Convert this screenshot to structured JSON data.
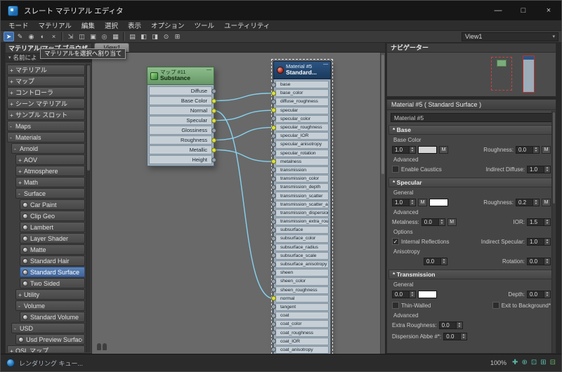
{
  "colors": {
    "wire": "#86d2ef",
    "socket_connected": "#dade4a",
    "selection_blue": "#40639a",
    "substance_header": "#699869",
    "material_header": "#1b3a5c",
    "statusbar_icon_teal": "#58b8a8"
  },
  "ui": {
    "minimize_glyph": "—",
    "dropdown_arrow": "▾",
    "check": "✓",
    "spin_up": "▲",
    "spin_down": "▼"
  },
  "window": {
    "title": "スレート マテリアル エディタ",
    "buttons": [
      {
        "name": "minimize-button",
        "glyph": "—"
      },
      {
        "name": "maximize-button",
        "glyph": "□"
      },
      {
        "name": "close-button",
        "glyph": "×"
      }
    ]
  },
  "menubar": {
    "items": [
      {
        "name": "menu-mode",
        "label": "モード"
      },
      {
        "name": "menu-material",
        "label": "マテリアル"
      },
      {
        "name": "menu-edit",
        "label": "編集"
      },
      {
        "name": "menu-select",
        "label": "選択"
      },
      {
        "name": "menu-view",
        "label": "表示"
      },
      {
        "name": "menu-options",
        "label": "オプション"
      },
      {
        "name": "menu-tools",
        "label": "ツール"
      },
      {
        "name": "menu-utilities",
        "label": "ユーティリティ"
      }
    ]
  },
  "toolbar": {
    "view_selector": "View1",
    "icons": [
      {
        "name": "select-tool-button",
        "glyph": "➤",
        "active": true
      },
      {
        "name": "pick-material-from-object-button",
        "glyph": "✎"
      },
      {
        "name": "put-material-to-scene-button",
        "glyph": "◉"
      },
      {
        "name": "assign-material-to-selection-button",
        "glyph": "◐"
      },
      {
        "name": "delete-selected-button",
        "glyph": "×"
      },
      {
        "name": "toolbar-separator",
        "sep": true
      },
      {
        "name": "move-children-button",
        "glyph": "⇲"
      },
      {
        "name": "hide-unused-nodeslots-button",
        "glyph": "◫"
      },
      {
        "name": "show-shaded-material-button",
        "glyph": "▣"
      },
      {
        "name": "show-end-result-button",
        "glyph": "◎"
      },
      {
        "name": "lay-out-all-button",
        "glyph": "▦"
      },
      {
        "name": "toolbar-separator",
        "sep": true
      },
      {
        "name": "lay-out-children-button",
        "glyph": "▤"
      },
      {
        "name": "material-map-browser-toggle-button",
        "glyph": "◧"
      },
      {
        "name": "parameter-editor-toggle-button",
        "glyph": "◨"
      },
      {
        "name": "select-by-material-button",
        "glyph": "⊙"
      },
      {
        "name": "zoom-extents-button",
        "glyph": "⊞"
      }
    ]
  },
  "browser": {
    "title": "マテリアル/マップ ブラウザ",
    "search_text": "名前によ",
    "tooltip": "マテリアルを選択へ割り当て",
    "items": [
      {
        "name": "browser-item-materials-group",
        "expander": "+",
        "label": "マテリアル",
        "indent": 0
      },
      {
        "name": "browser-item-maps-group",
        "expander": "+",
        "label": "マップ",
        "indent": 0
      },
      {
        "name": "browser-item-controllers",
        "expander": "+",
        "label": "コントローラ",
        "indent": 0
      },
      {
        "name": "browser-item-scene-materials",
        "expander": "+",
        "label": "シーン マテリアル",
        "indent": 0
      },
      {
        "name": "browser-item-sample-slots",
        "expander": "+",
        "label": "サンプル スロット",
        "indent": 0
      },
      {
        "expander": "-",
        "label": "Maps",
        "indent": 0
      },
      {
        "expander": "-",
        "label": "Materials",
        "indent": 0
      },
      {
        "expander": "-",
        "label": "Arnold",
        "indent": 1
      },
      {
        "expander": "+",
        "label": "AOV",
        "indent": 2
      },
      {
        "expander": "+",
        "label": "Atmosphere",
        "indent": 2
      },
      {
        "expander": "+",
        "label": "Math",
        "indent": 2
      },
      {
        "expander": "-",
        "label": "Surface",
        "indent": 2
      },
      {
        "icon": "ball",
        "label": "Car Paint",
        "indent": 3
      },
      {
        "icon": "ball",
        "label": "Clip Geo",
        "indent": 3
      },
      {
        "icon": "ball",
        "label": "Lambert",
        "indent": 3
      },
      {
        "icon": "ball",
        "label": "Layer Shader",
        "indent": 3
      },
      {
        "icon": "ball",
        "label": "Matte",
        "indent": 3
      },
      {
        "icon": "ball",
        "label": "Standard Hair",
        "indent": 3
      },
      {
        "icon": "ball",
        "label": "Standard Surface",
        "indent": 3,
        "selected": true
      },
      {
        "icon": "ball",
        "label": "Two Sided",
        "indent": 3
      },
      {
        "expander": "+",
        "label": "Utility",
        "indent": 2
      },
      {
        "expander": "-",
        "label": "Volume",
        "indent": 2
      },
      {
        "icon": "ball",
        "label": "Standard Volume",
        "indent": 3
      },
      {
        "expander": "-",
        "label": "USD",
        "indent": 1
      },
      {
        "icon": "ball",
        "label": "Usd Preview Surface",
        "indent": 2
      },
      {
        "name": "browser-item-osl-maps",
        "expander": "+",
        "label": "OSL マップ",
        "indent": 0
      }
    ]
  },
  "canvas": {
    "tab": "View1",
    "nodes": {
      "substance": {
        "title": "マップ #11",
        "subtitle": "Substance",
        "outputs": [
          {
            "label": "Diffuse"
          },
          {
            "label": "Base Color",
            "connected": true
          },
          {
            "label": "Normal",
            "connected": true
          },
          {
            "label": "Specular",
            "connected": true
          },
          {
            "label": "Glossiness"
          },
          {
            "label": "Roughness",
            "connected": true
          },
          {
            "label": "Metallic",
            "connected": true
          },
          {
            "label": "Height"
          }
        ]
      },
      "material": {
        "title": "Material #5",
        "subtitle": "Standard...",
        "inputs": [
          {
            "label": "base"
          },
          {
            "label": "base_color",
            "connected": true
          },
          {
            "label": "diffuse_roughness"
          },
          {
            "label": "specular",
            "connected": true
          },
          {
            "label": "specular_color"
          },
          {
            "label": "specular_roughness",
            "connected": true
          },
          {
            "label": "specular_IOR"
          },
          {
            "label": "specular_anisotropy"
          },
          {
            "label": "specular_rotation"
          },
          {
            "label": "metalness",
            "connected": true
          },
          {
            "label": "transmission"
          },
          {
            "label": "transmission_color"
          },
          {
            "label": "transmission_depth"
          },
          {
            "label": "transmission_scatter"
          },
          {
            "label": "transmission_scatter_ani..."
          },
          {
            "label": "transmission_dispersion*"
          },
          {
            "label": "transmission_extra_roug..."
          },
          {
            "label": "subsurface"
          },
          {
            "label": "subsurface_color"
          },
          {
            "label": "subsurface_radius"
          },
          {
            "label": "subsurface_scale"
          },
          {
            "label": "subsurface_anisotropy"
          },
          {
            "label": "sheen"
          },
          {
            "label": "sheen_color"
          },
          {
            "label": "sheen_roughness"
          },
          {
            "label": "normal",
            "connected": true
          },
          {
            "label": "tangent"
          },
          {
            "label": "coat"
          },
          {
            "label": "coat_color"
          },
          {
            "label": "coat_roughness"
          },
          {
            "label": "coat_IOR"
          },
          {
            "label": "coat_anisotropy"
          }
        ]
      }
    },
    "connections": [
      {
        "from": "Base Color",
        "to": "base_color"
      },
      {
        "from": "Normal",
        "to": "normal"
      },
      {
        "from": "Specular",
        "to": "specular"
      },
      {
        "from": "Roughness",
        "to": "specular_roughness"
      },
      {
        "from": "Metallic",
        "to": "metalness"
      }
    ]
  },
  "navigator": {
    "title": "ナビゲーター"
  },
  "params": {
    "header": "Material #5  ( Standard Surface )",
    "name_value": "Material #5",
    "map_button": "M",
    "base": {
      "title": "* Base",
      "color_label": "Base Color",
      "weight": "1.0",
      "swatch_color": "#d4d4d4",
      "roughness_label": "Roughness:",
      "roughness_value": "0.0",
      "advanced": "Advanced",
      "enable_caustics": "Enable Caustics",
      "indirect_diffuse_label": "Indirect Diffuse:",
      "indirect_diffuse_value": "1.0"
    },
    "specular": {
      "title": "* Specular",
      "general": "General",
      "weight": "1.0",
      "swatch_color": "#ffffff",
      "roughness_label": "Roughness:",
      "roughness_value": "0.2",
      "advanced": "Advanced",
      "metalness_label": "Metalness:",
      "metalness_value": "0.0",
      "ior_label": "IOR:",
      "ior_value": "1.5",
      "options": "Options",
      "internal_reflections": "Internal Reflections",
      "indirect_specular_label": "Indirect Specular:",
      "indirect_specular_value": "1.0",
      "anisotropy": "Anisotropy",
      "anisotropy_value": "0.0",
      "rotation_label": "Rotation:",
      "rotation_value": "0.0"
    },
    "transmission": {
      "title": "* Transmission",
      "general": "General",
      "weight": "0.0",
      "swatch_color": "#ffffff",
      "depth_label": "Depth:",
      "depth_value": "0.0",
      "thin_walled": "Thin-Walled",
      "exit_to_background": "Exit to Background*",
      "advanced": "Advanced",
      "extra_roughness_label": "Extra Roughness:",
      "extra_roughness_value": "0.0",
      "dispersion_label": "Dispersion Abbe #*:",
      "dispersion_value": "0.0"
    }
  },
  "statusbar": {
    "text": "レンダリング キュー...",
    "zoom": "100%",
    "icons": [
      {
        "name": "pan-tool-icon",
        "glyph": "✚",
        "color": "#58b8a8"
      },
      {
        "name": "zoom-tool-icon",
        "glyph": "⊕",
        "color": "#58b8a8"
      },
      {
        "name": "zoom-region-tool-icon",
        "glyph": "⊡",
        "color": "#58b8a8"
      },
      {
        "name": "zoom-extents-tool-icon",
        "glyph": "⊞",
        "color": "#58b8a8"
      },
      {
        "name": "zoom-extents-selected-tool-icon",
        "glyph": "⊟",
        "color": "#67b06b"
      }
    ]
  }
}
